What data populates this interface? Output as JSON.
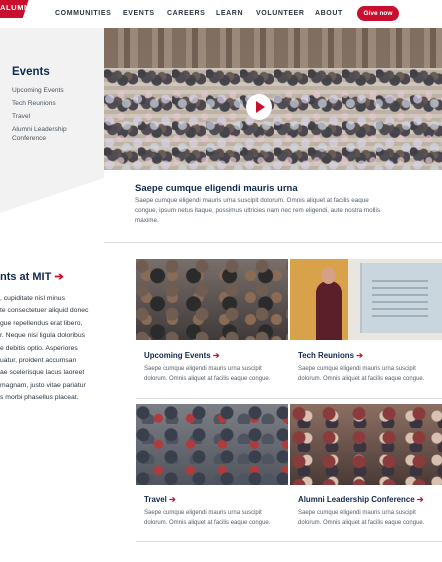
{
  "header": {
    "logo_text": "ALUMNI",
    "nav": [
      "COMMUNITIES",
      "EVENTS",
      "CAREERS",
      "LEARN",
      "VOLUNTEER",
      "ABOUT"
    ],
    "give_label": "Give now"
  },
  "sidebar": {
    "title": "Events",
    "items": [
      {
        "label": "Upcoming Events"
      },
      {
        "label": "Tech Reunions"
      },
      {
        "label": "Travel"
      },
      {
        "label": "Alumni Leadership Conference"
      }
    ]
  },
  "hero": {
    "title": "Saepe cumque eligendi mauris urna",
    "description": "Saepe cumque eligendi mauris urna suscipit dolorum. Omnis aliquet at facilis eaque congue, ipsum netus itaque, possimus ultricies nam nec rem eligendi, aute nostra mollis maxime."
  },
  "section": {
    "title": "nts at MIT",
    "arrow": "➔",
    "body_lines": [
      ", cupiditate nisl minus",
      "te consectetuer aliquid donec",
      "gue repellendus erat libero,",
      "r. Neque nisi ligula doloribus",
      "e debitis optio. Asperiores",
      "uatur, proident accumsan",
      "ae scelerisque lacus laoreet",
      "magnam, justo vitae pariatur",
      "s morbi phasellus placeat."
    ]
  },
  "cards": [
    {
      "title": "Upcoming Events",
      "arrow": "➔",
      "description": "Saepe cumque eligendi mauris urna suscipit dolorum. Omnis aliquet at facilis eaque congue."
    },
    {
      "title": "Tech Reunions",
      "arrow": "➔",
      "description": "Saepe cumque eligendi mauris urna suscipit dolorum. Omnis aliquet at facilis eaque congue."
    },
    {
      "title": "Travel",
      "arrow": "➔",
      "description": "Saepe cumque eligendi mauris urna suscipit dolorum. Omnis aliquet at facilis eaque congue."
    },
    {
      "title": "Alumni Leadership Conference",
      "arrow": "➔",
      "description": "Saepe cumque eligendi mauris urna suscipit dolorum. Omnis aliquet at facilis eaque congue."
    }
  ],
  "colors": {
    "accent": "#c8102e",
    "navy": "#12294f",
    "panel": "#f2f2f2"
  }
}
